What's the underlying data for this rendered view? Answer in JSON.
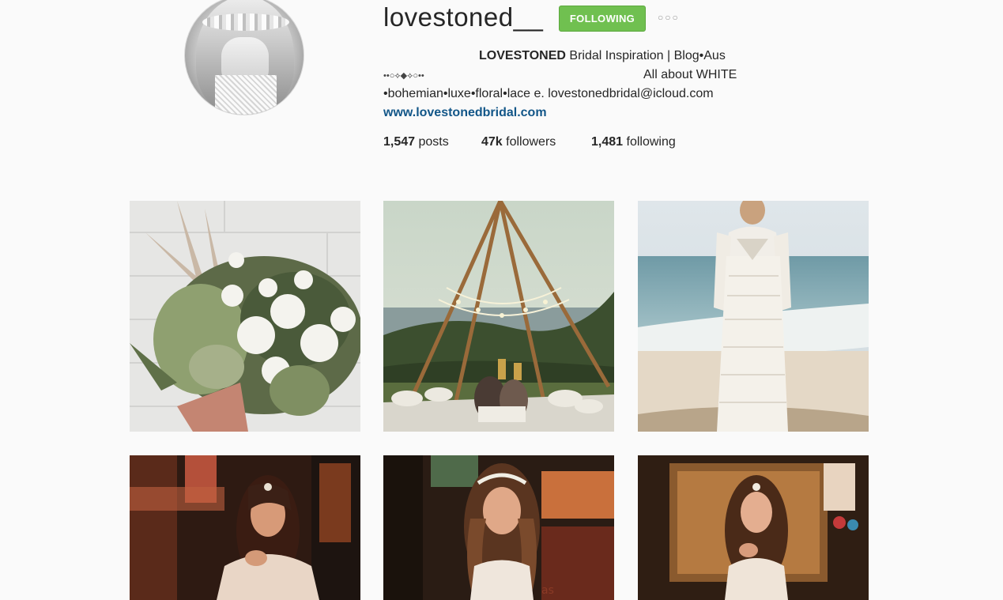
{
  "profile": {
    "username": "lovestoned__",
    "follow_button_label": "FOLLOWING",
    "more_icon": "ellipsis-icon",
    "bio_name": "LOVESTONED",
    "bio_line1_rest": " Bridal Inspiration | Blog•Aus",
    "bio_line2_ornament": "••○⟡◆⟡○••",
    "bio_line2_text": "All about WHITE",
    "bio_line3": "•bohemian•luxe•floral•lace e. lovestonedbridal@icloud.com",
    "website": "www.lovestonedbridal.com"
  },
  "stats": {
    "posts_count": "1,547",
    "posts_label": " posts",
    "followers_count": "47k",
    "followers_label": " followers",
    "following_count": "1,481",
    "following_label": " following"
  },
  "colors": {
    "follow_button": "#70c050",
    "link": "#125688",
    "background": "#fafafa"
  }
}
